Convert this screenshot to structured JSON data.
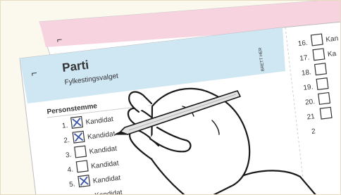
{
  "ballot": {
    "corner_mark": "⌐",
    "party": "Parti",
    "election": "Fylkestingsvalget",
    "fold_label": "BRETT HER",
    "section": "Personstemme",
    "candidate_label": "Kandidat",
    "left_numbers": [
      "1.",
      "2.",
      "3.",
      "4.",
      "5."
    ],
    "left_checked": [
      true,
      true,
      false,
      false,
      true
    ],
    "right_numbers": [
      "16.",
      "17.",
      "18.",
      "19.",
      "20.",
      "21",
      "2"
    ],
    "right_labels": [
      "Kan",
      "Ka",
      "",
      "",
      "",
      "",
      ""
    ]
  },
  "colors": {
    "back_ballot": "#f7d3df",
    "header_blue": "#cfe6f3",
    "checkmark": "#3a55a8",
    "page_bg": "#fbf8ee"
  },
  "icons": [
    "pen-icon",
    "hand-illustration"
  ]
}
